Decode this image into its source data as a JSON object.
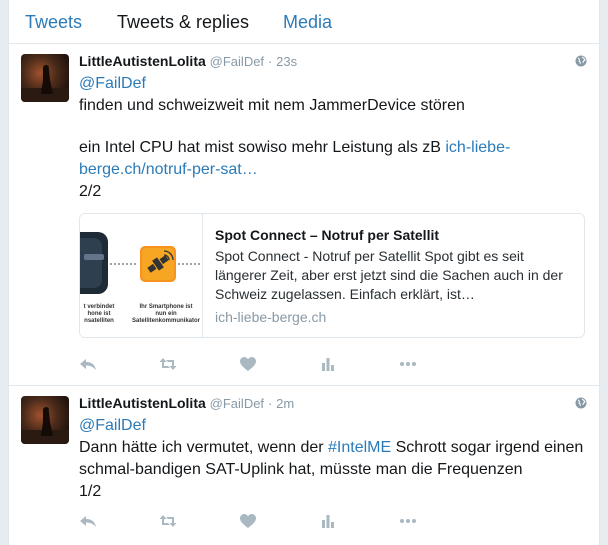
{
  "tabs": [
    {
      "label": "Tweets"
    },
    {
      "label": "Tweets & replies"
    },
    {
      "label": "Media"
    }
  ],
  "tweets": [
    {
      "name": "LittleAutistenLolita",
      "handle": "@FailDef",
      "dot": "·",
      "time": "23s",
      "mention": "@FailDef",
      "line1": "finden und schweizweit mit nem JammerDevice stören",
      "line2_pre": "ein Intel CPU hat mist sowiso mehr Leistung als zB ",
      "line2_link": "ich-liebe-berge.ch/notruf-per-sat…",
      "line3": "2/2",
      "card": {
        "title": "Spot Connect – Notruf per Satellit",
        "description": "Spot Connect - Notruf per Satellit Spot gibt es seit längerer Zeit, aber erst jetzt sind die Sachen auch in der Schweiz zugelassen. Einfach erklärt, ist…",
        "domain": "ich-liebe-berge.ch",
        "image_caption_left": "...t verbindet\n...hone ist\n...nsatelliten",
        "image_caption_right": "Ihr Smartphone ist\nnun ein\nSatellitenkommunikator"
      }
    },
    {
      "name": "LittleAutistenLolita",
      "handle": "@FailDef",
      "dot": "·",
      "time": "2m",
      "mention": "@FailDef",
      "line1_pre": "Dann hätte ich vermutet, wenn der ",
      "hashtag": "#IntelME",
      "line1_post": " Schrott sogar irgend einen",
      "line2": "schmal-bandigen SAT-Uplink hat, müsste man die Frequenzen",
      "line3": "1/2"
    }
  ],
  "colors": {
    "link": "#2b7bb9",
    "muted": "#8899a6",
    "border": "#e1e8ed",
    "icon": "#aab8c2"
  }
}
